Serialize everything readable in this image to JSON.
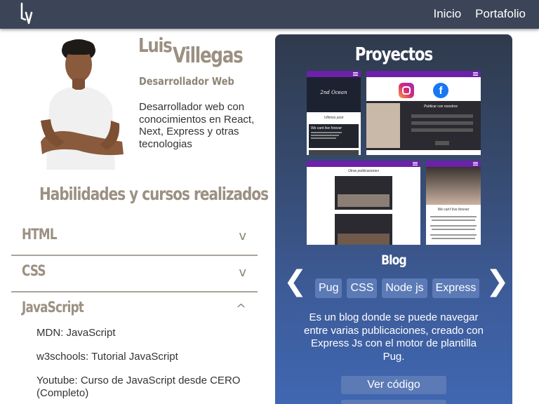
{
  "navbar": {
    "logo_icon": "lv-monogram-logo",
    "links": [
      "Inicio",
      "Portafolio"
    ]
  },
  "profile": {
    "first_name": "Luis",
    "last_name": "Villegas",
    "role": "Desarrollador Web",
    "bio": "Desarrollador web con conocimientos en React, Next, Express y otras tecnologias",
    "avatar": "profile-photo"
  },
  "skills": {
    "title": "Habilidades y cursos realizados",
    "sections": [
      {
        "label": "HTML",
        "chevron": "v",
        "expanded": false,
        "courses": []
      },
      {
        "label": "CSS",
        "chevron": "v",
        "expanded": false,
        "courses": []
      },
      {
        "label": "JavaScript",
        "chevron": "^",
        "expanded": true,
        "courses": [
          "MDN: JavaScript",
          "w3schools: Tutorial JavaScript",
          "Youtube: Curso de JavaScript desde CERO (Completo)"
        ]
      }
    ]
  },
  "projects": {
    "title": "Proyectos",
    "current": {
      "name": "Blog",
      "tags": [
        "Pug",
        "CSS",
        "Node js",
        "Express"
      ],
      "description": "Es un blog donde se puede navegar entre varias publicaciones, creado con Express Js con el motor de plantilla Pug.",
      "code_button": "Ver código",
      "screenshots": {
        "s1_title": "2nd Ocean",
        "s1_caption": "Ultimos post",
        "s1_post": "We cant live forever",
        "s2_title": "Publicar con nosotros",
        "s3_title": "Otras publicaciones",
        "s4_title": "We can't live forever"
      }
    },
    "prev_icon": "chevron-left-icon",
    "next_icon": "chevron-right-icon"
  },
  "colors": {
    "navbar": "#3c4558",
    "accent_text": "#9b9082",
    "card_top": "#2f3a4c",
    "card_bottom": "#4068b4",
    "tag_bg": "#5b7ab6",
    "project_bar": "#6b21a8"
  }
}
